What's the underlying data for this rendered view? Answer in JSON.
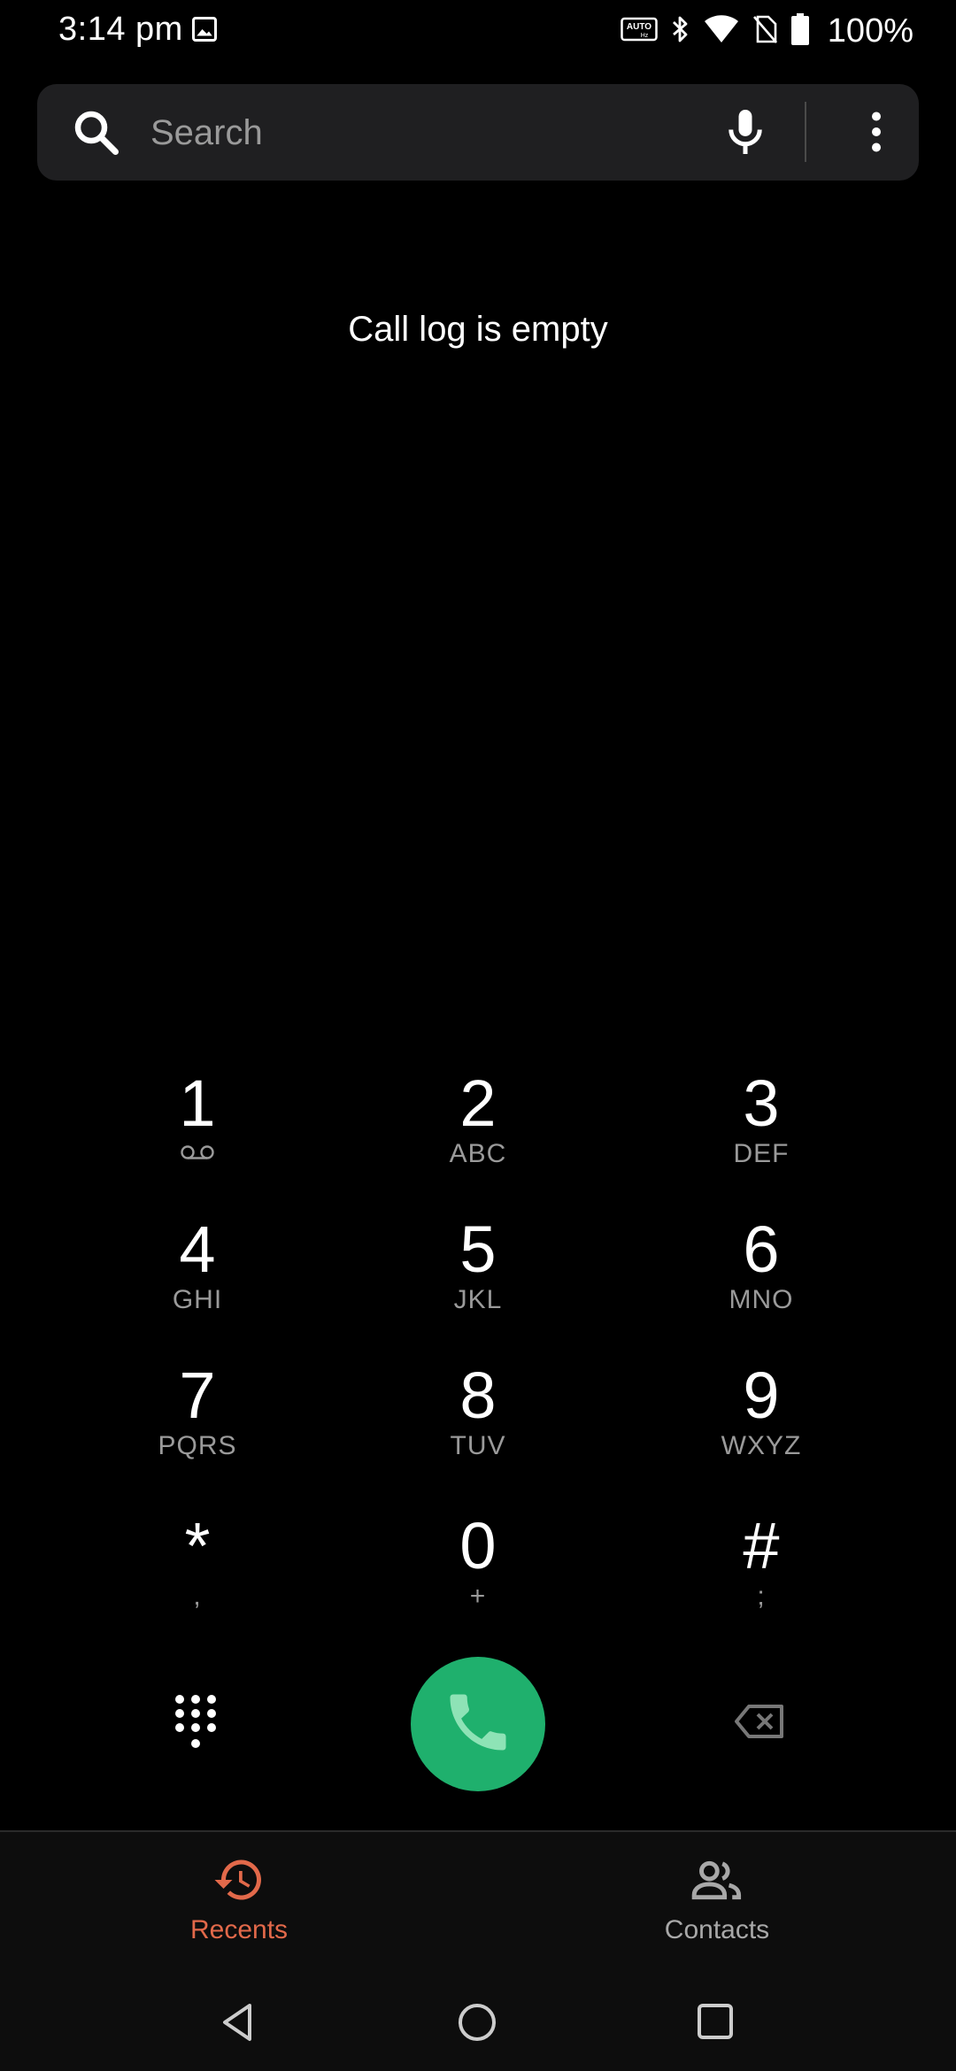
{
  "status_bar": {
    "time": "3:14 pm",
    "battery": "100%",
    "icons": [
      "image-icon",
      "auto-hz-icon",
      "bluetooth-icon",
      "wifi-icon",
      "no-sim-icon",
      "battery-icon"
    ]
  },
  "search": {
    "placeholder": "Search"
  },
  "call_log": {
    "empty_message": "Call log is empty"
  },
  "dialpad": {
    "keys": [
      {
        "digit": "1",
        "letters": ""
      },
      {
        "digit": "2",
        "letters": "ABC"
      },
      {
        "digit": "3",
        "letters": "DEF"
      },
      {
        "digit": "4",
        "letters": "GHI"
      },
      {
        "digit": "5",
        "letters": "JKL"
      },
      {
        "digit": "6",
        "letters": "MNO"
      },
      {
        "digit": "7",
        "letters": "PQRS"
      },
      {
        "digit": "8",
        "letters": "TUV"
      },
      {
        "digit": "9",
        "letters": "WXYZ"
      },
      {
        "digit": "*",
        "letters": ","
      },
      {
        "digit": "0",
        "letters": "+"
      },
      {
        "digit": "#",
        "letters": ";"
      }
    ],
    "call_button_color": "#1fb06d"
  },
  "bottom_nav": {
    "tabs": [
      {
        "label": "Recents",
        "icon": "history-icon",
        "active": true
      },
      {
        "label": "Contacts",
        "icon": "people-icon",
        "active": false
      }
    ],
    "active_color": "#e2694a"
  }
}
